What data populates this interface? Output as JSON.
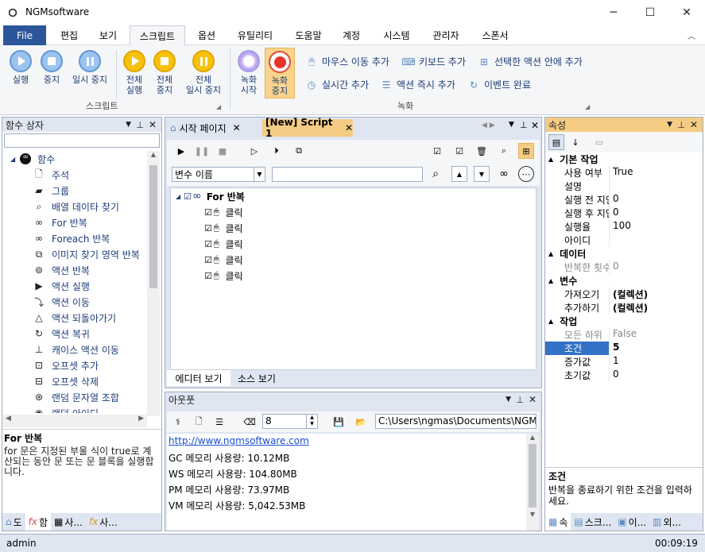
{
  "app": {
    "title": "NGMsoftware"
  },
  "window": {
    "minimize": "─",
    "maximize": "☐",
    "close": "✕"
  },
  "menu": {
    "tabs": [
      "File",
      "편집",
      "보기",
      "스크립트",
      "옵션",
      "유틸리티",
      "도움말",
      "계정",
      "시스템",
      "관리자",
      "스폰서"
    ],
    "collapse": "︿"
  },
  "ribbon": {
    "script_group": "스크립트",
    "record_group": "녹화",
    "run": "실행",
    "stop": "중지",
    "pause": "일시 중지",
    "run_all": "전체\n실행",
    "stop_all": "전체\n중지",
    "pause_all": "전체\n일시 중지",
    "record_start": "녹화\n시작",
    "record_stop": "녹화\n중지",
    "mouse_move": "마우스 이동 추가",
    "keyboard": "키보드 추가",
    "inside_action": "선택한 액션 안에 추가",
    "realtime": "실시간 추가",
    "instant": "액션 즉시 추가",
    "event_done": "이벤트 완료"
  },
  "left": {
    "header": "함수 상자",
    "root": "함수",
    "items": [
      "주석",
      "그룹",
      "배열 데이타 찾기",
      "For 반복",
      "Foreach 반복",
      "이미지 찾기 영역 반복",
      "액션 반복",
      "액션 실행",
      "액션 이동",
      "액션 되돌아가기",
      "액션 복귀",
      "캐이스 액션 이동",
      "오프셋 추가",
      "오프셋 삭제",
      "랜덤 문자열 조합",
      "랜덤 아이디"
    ],
    "icons": [
      "note-icon",
      "group-icon",
      "search-icon",
      "loop-icon",
      "loop-icon",
      "image-loop-icon",
      "repeat-icon",
      "play-icon",
      "move-icon",
      "undo-icon",
      "return-icon",
      "branch-icon",
      "offset-add-icon",
      "offset-remove-icon",
      "random-icon",
      "random-id-icon"
    ],
    "desc_title": "For 반복",
    "desc_text": "for 문은 지정된 부울 식이 true로 계산되는 동안 문 또는 문 블록을 실행합니다.",
    "tabs": [
      "도",
      "함",
      "사...",
      "사..."
    ]
  },
  "editor": {
    "tabs": [
      "시작 페이지",
      "[New] Script 1"
    ],
    "var_select": "변수 이름",
    "tree_root": "For 반복",
    "nodes": [
      "클릭",
      "클릭",
      "클릭",
      "클릭",
      "클릭"
    ],
    "bottom_tabs": [
      "에디터 보기",
      "소스 보기"
    ]
  },
  "output": {
    "header": "아웃풋",
    "spin": "8",
    "path": "C:\\Users\\ngmas\\Documents\\NGM6\\",
    "lines": [
      "http://www.ngmsoftware.com",
      "GC 메모리 사용량: 10.12MB",
      "WS 메모리 사용량: 104.80MB",
      "PM 메모리 사용량: 73.97MB",
      "VM 메모리 사용량: 5,042.53MB"
    ]
  },
  "props": {
    "header": "속성",
    "cats": [
      "기본 작업",
      "데이터",
      "변수",
      "작업"
    ],
    "basic": [
      [
        "사용 여부",
        "True"
      ],
      [
        "설명",
        ""
      ],
      [
        "실행 전 지연",
        "0"
      ],
      [
        "실행 후 지연",
        "0"
      ],
      [
        "실행율",
        "100"
      ],
      [
        "아이디",
        ""
      ]
    ],
    "data": [
      [
        "반복한 횟수",
        "0"
      ]
    ],
    "vars": [
      [
        "가져오기",
        "(컬렉션)"
      ],
      [
        "추가하기",
        "(컬렉션)"
      ]
    ],
    "work": [
      [
        "모든 하위",
        "False"
      ],
      [
        "조건",
        "5"
      ],
      [
        "증가값",
        "1"
      ],
      [
        "초기값",
        "0"
      ]
    ],
    "desc_title": "조건",
    "desc_text": "반복을 종료하기 위한 조건을 입력하세요.",
    "tabs": [
      "속",
      "스크...",
      "이...",
      "외..."
    ]
  },
  "status": {
    "user": "admin",
    "time": "00:09:19"
  },
  "colors": {
    "accent": "#2b579a",
    "highlight": "#f5cc84",
    "panel_bg": "#dfe6f1"
  }
}
